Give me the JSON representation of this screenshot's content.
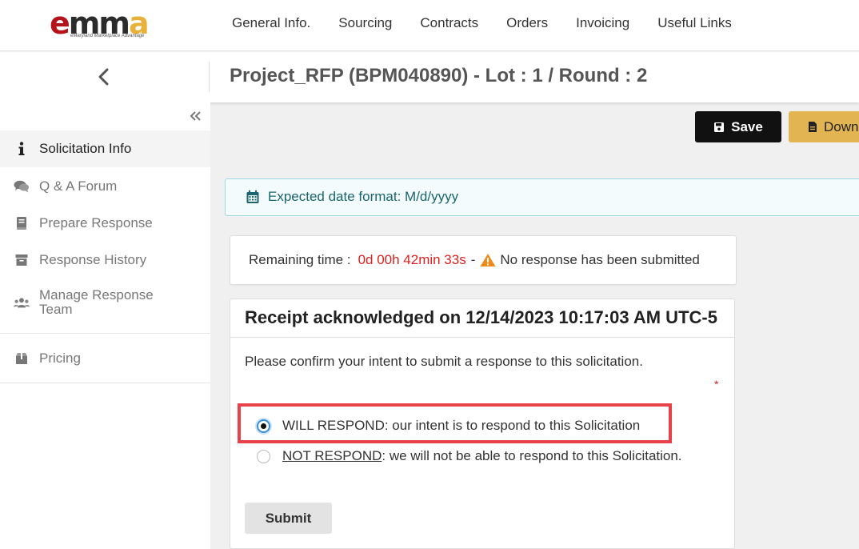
{
  "app": {
    "logo_text": "emma",
    "logo_tagline": "eMaryland Marketplace Advantage"
  },
  "nav": {
    "items": [
      "General Info.",
      "Sourcing",
      "Contracts",
      "Orders",
      "Invoicing",
      "Useful Links"
    ]
  },
  "header": {
    "title": "Project_RFP (BPM040890) - Lot : 1 / Round : 2"
  },
  "sidebar": {
    "items": [
      {
        "label": "Solicitation Info",
        "icon": "info-icon",
        "active": true
      },
      {
        "label": "Q & A Forum",
        "icon": "chat-icon",
        "active": false
      },
      {
        "label": "Prepare Response",
        "icon": "book-icon",
        "active": false
      },
      {
        "label": "Response History",
        "icon": "archive-icon",
        "active": false
      },
      {
        "label": "Manage Response Team",
        "icon": "users-icon",
        "active": false
      },
      {
        "label": "Pricing",
        "icon": "box-icon",
        "active": false
      }
    ]
  },
  "toolbar": {
    "save_label": "Save",
    "download_label": "Down"
  },
  "info_banner": {
    "text": "Expected date format: M/d/yyyy"
  },
  "timer": {
    "label": "Remaining time :",
    "value": "0d 00h 42min 33s",
    "separator": "-",
    "status": "No response has been submitted"
  },
  "receipt": {
    "title": "Receipt acknowledged on 12/14/2023 10:17:03 AM UTC-5",
    "prompt": "Please confirm your intent to submit a response to this solicitation.",
    "required_mark": "*",
    "options": [
      {
        "label": "WILL RESPOND: our intent is to respond to this Solicitation",
        "selected": true
      },
      {
        "label_underlined": "NOT RESPOND",
        "label_rest": ": we will not be able to respond to this Solicitation.",
        "selected": false
      }
    ],
    "submit_label": "Submit"
  },
  "colors": {
    "accent_red": "#e02020",
    "highlight": "#e8414a",
    "save_bg": "#111111",
    "download_bg": "#e2b552",
    "info_text": "#1a6570"
  }
}
